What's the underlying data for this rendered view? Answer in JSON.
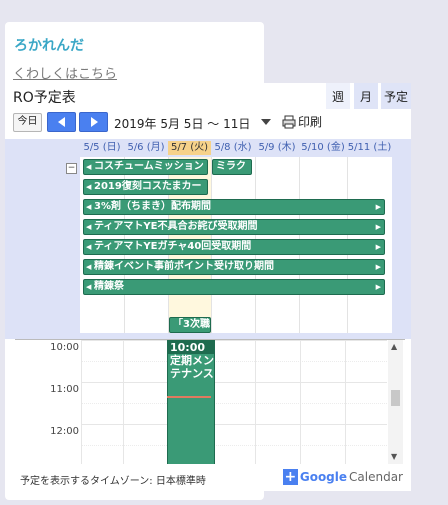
{
  "site": {
    "title": "ろかれんだ",
    "details_link": "くわしくはこちら"
  },
  "calendar": {
    "title": "RO予定表",
    "today_button": "今日",
    "date_range": "2019年 5月 5日 ～ 11日",
    "print_label": "印刷",
    "tabs": [
      "週",
      "月",
      "予定"
    ],
    "days": [
      "5/5 (日)",
      "5/6 (月)",
      "5/7 (火)",
      "5/8 (水)",
      "5/9 (木)",
      "5/10 (金)",
      "5/11 (土)"
    ],
    "today_index": 2,
    "allday_events": [
      "コスチュームミッション",
      "ミラク",
      "2019復刻コスたまカー",
      "3%剤（ちまき）配布期間",
      "ティアマトYE不具合お詫び受取期間",
      "ティアマトYEガチャ40回受取期間",
      "精錬イベント事前ポイント受け取り期間",
      "精錬祭",
      "「3次職"
    ],
    "times": [
      "10:00",
      "11:00",
      "12:00"
    ],
    "timed_event": {
      "time": "10:00",
      "title": "定期メンテナンス"
    },
    "timezone_text": "予定を表示するタイムゾーン: 日本標準時",
    "branding": {
      "google": "Google",
      "calendar": "Calendar"
    }
  },
  "colors": {
    "event": "#3a9a76",
    "accent": "#4a80f0",
    "title": "#3aa7c6",
    "today": "#f6d28a"
  }
}
